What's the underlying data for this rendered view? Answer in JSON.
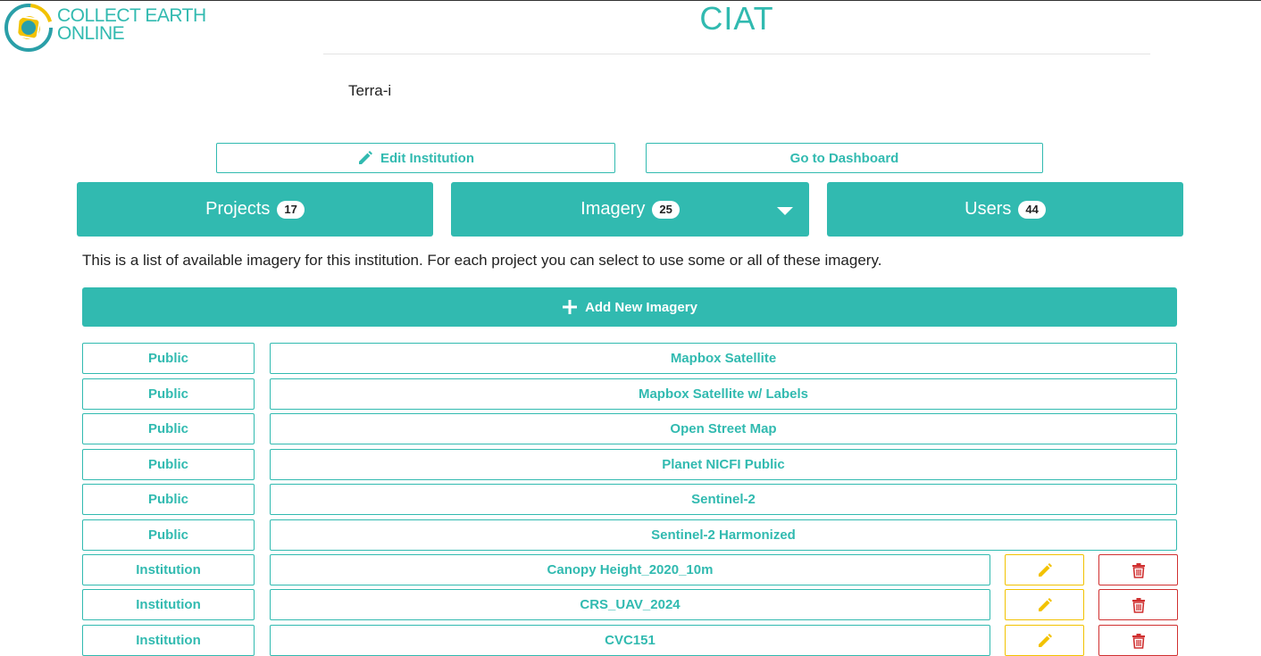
{
  "header": {
    "logo_line1": "COLLECT EARTH",
    "logo_line2": "ONLINE",
    "institution_name": "CIAT",
    "institution_description": "Terra-i"
  },
  "actions": {
    "edit_institution": "Edit Institution",
    "go_to_dashboard": "Go to Dashboard"
  },
  "tabs": {
    "projects": {
      "label": "Projects",
      "count": "17"
    },
    "imagery": {
      "label": "Imagery",
      "count": "25"
    },
    "users": {
      "label": "Users",
      "count": "44"
    }
  },
  "imagery": {
    "info_text": "This is a list of available imagery for this institution. For each project you can select to use some or all of these imagery.",
    "add_label": "Add New Imagery",
    "rows": [
      {
        "visibility": "Public",
        "title": "Mapbox Satellite",
        "editable": false
      },
      {
        "visibility": "Public",
        "title": "Mapbox Satellite w/ Labels",
        "editable": false
      },
      {
        "visibility": "Public",
        "title": "Open Street Map",
        "editable": false
      },
      {
        "visibility": "Public",
        "title": "Planet NICFI Public",
        "editable": false
      },
      {
        "visibility": "Public",
        "title": "Sentinel-2",
        "editable": false
      },
      {
        "visibility": "Public",
        "title": "Sentinel-2 Harmonized",
        "editable": false
      },
      {
        "visibility": "Institution",
        "title": "Canopy Height_2020_10m",
        "editable": true
      },
      {
        "visibility": "Institution",
        "title": "CRS_UAV_2024",
        "editable": true
      },
      {
        "visibility": "Institution",
        "title": "CVC151",
        "editable": true
      }
    ]
  },
  "colors": {
    "accent": "#31bab0",
    "edit": "#f2c200",
    "delete": "#d03030"
  }
}
